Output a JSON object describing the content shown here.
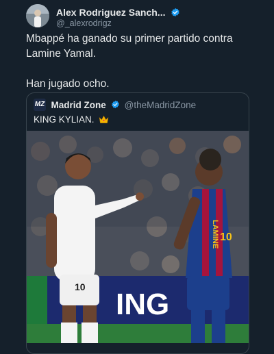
{
  "tweet": {
    "author_name": "Alex Rodriguez Sanch...",
    "handle": "@_alexrodrigz",
    "text_line1": "Mbappé ha ganado su primer partido contra Lamine Yamal.",
    "text_line2": "Han jugado ocho."
  },
  "quote": {
    "logo_text": "MZ",
    "author_name": "Madrid Zone",
    "handle": "@theMadridZone",
    "text": "KING KYLIAN."
  },
  "photo": {
    "left_player_number": "10",
    "right_player_number": "10",
    "right_player_name": "LAMINE",
    "board_text": "ING"
  },
  "colors": {
    "background": "#15202b",
    "verified_badge": "#1d9bf0",
    "secondary_text": "#8b98a5",
    "barca_blue": "#1c3f8c",
    "barca_red": "#a5143c"
  },
  "icons": {
    "verified": "verified-badge-icon",
    "crown": "crown-emoji-icon"
  }
}
